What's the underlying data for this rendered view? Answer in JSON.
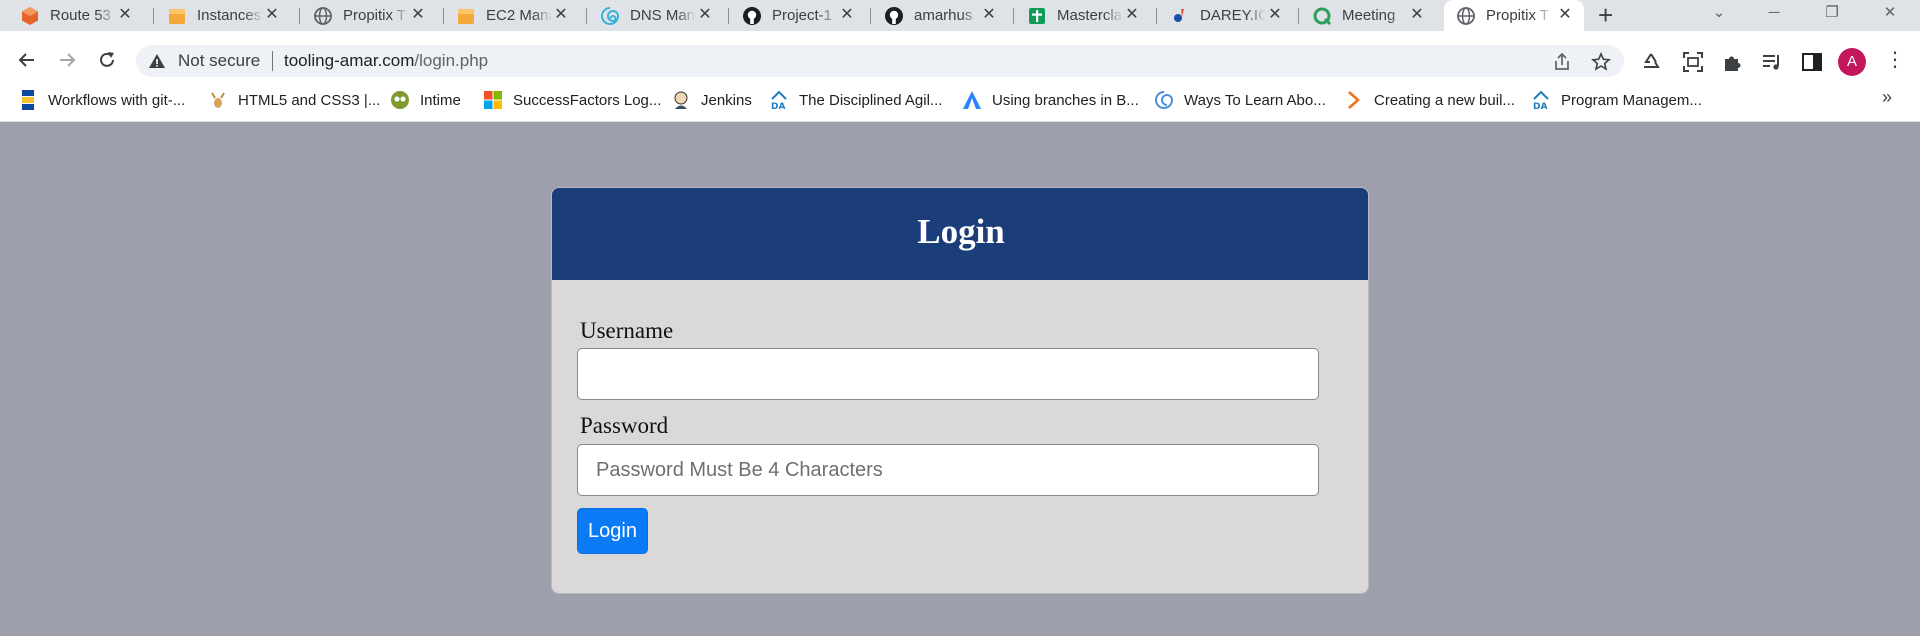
{
  "browser": {
    "tabs": [
      {
        "title": "Route 53",
        "icon": "aws-route53-icon"
      },
      {
        "title": "Instances",
        "icon": "aws-box-icon"
      },
      {
        "title": "Propitix T",
        "icon": "globe-icon"
      },
      {
        "title": "EC2 Mana",
        "icon": "aws-box-icon"
      },
      {
        "title": "DNS Man",
        "icon": "dns-spiral-icon"
      },
      {
        "title": "Project-1",
        "icon": "github-icon"
      },
      {
        "title": "amarhus",
        "icon": "github-icon"
      },
      {
        "title": "Mastercla",
        "icon": "sheets-icon"
      },
      {
        "title": "DAREY.IO",
        "icon": "darey-icon"
      },
      {
        "title": "Meeting",
        "icon": "meeting-icon"
      },
      {
        "title": "Propitix T",
        "icon": "globe-icon",
        "active": true
      }
    ],
    "address_bar": {
      "security_text": "Not secure",
      "host": "tooling-amar.com",
      "path": "/login.php"
    },
    "profile_initial": "A",
    "bookmarks": [
      {
        "label": "Workflows with git-...",
        "icon": "git-bookmark-icon"
      },
      {
        "label": "HTML5 and CSS3 |...",
        "icon": "deer-icon"
      },
      {
        "label": "Intime",
        "icon": "owl-icon"
      },
      {
        "label": "SuccessFactors Log...",
        "icon": "microsoft-icon"
      },
      {
        "label": "Jenkins",
        "icon": "jenkins-icon"
      },
      {
        "label": "The Disciplined Agil...",
        "icon": "da-icon"
      },
      {
        "label": "Using branches in B...",
        "icon": "atlassian-icon"
      },
      {
        "label": "Ways To Learn Abo...",
        "icon": "swirl-icon"
      },
      {
        "label": "Creating a new buil...",
        "icon": "chevron-orange-icon"
      },
      {
        "label": "Program Managem...",
        "icon": "da-icon"
      }
    ]
  },
  "login": {
    "title": "Login",
    "username_label": "Username",
    "username_value": "",
    "password_label": "Password",
    "password_placeholder": "Password Must Be 4 Characters",
    "submit_label": "Login"
  },
  "colors": {
    "page_bg": "#9e9fac",
    "card_header": "#1b3e7a",
    "card_body": "#dad8d9",
    "button": "#0a7bf4",
    "annotation_underline": "#d41f1f"
  }
}
